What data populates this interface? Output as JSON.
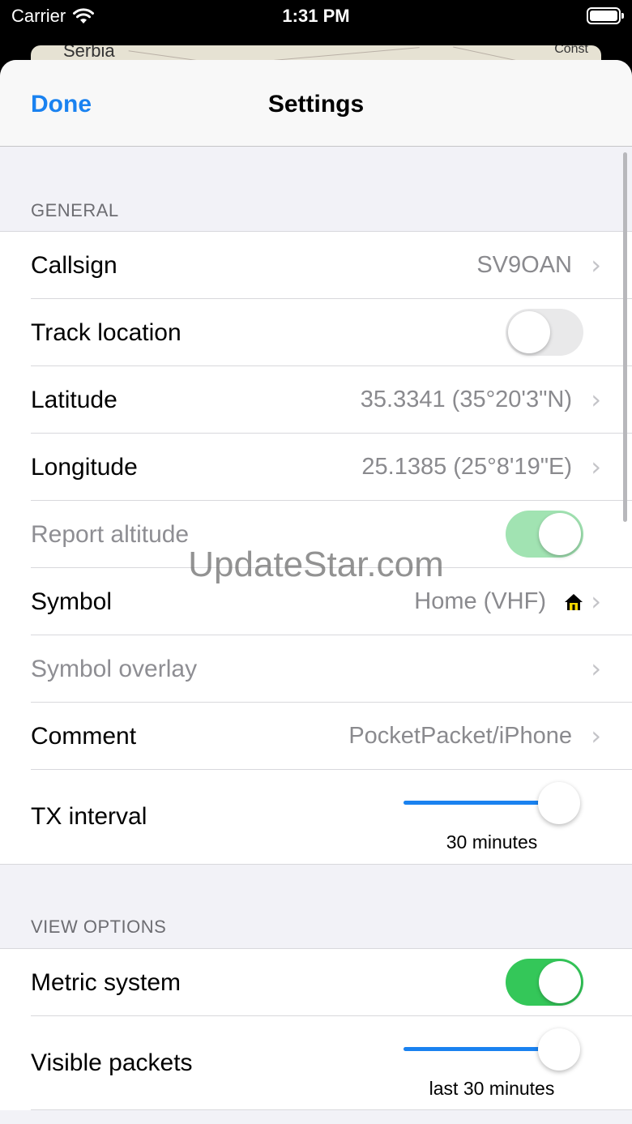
{
  "status_bar": {
    "carrier": "Carrier",
    "time": "1:31 PM"
  },
  "map": {
    "label_left": "Serbia",
    "label_right": "Const"
  },
  "nav": {
    "done_label": "Done",
    "title": "Settings"
  },
  "general": {
    "header": "GENERAL",
    "callsign": {
      "label": "Callsign",
      "value": "SV9OAN"
    },
    "track_location": {
      "label": "Track location",
      "on": false
    },
    "latitude": {
      "label": "Latitude",
      "value": "35.3341 (35°20'3\"N)"
    },
    "longitude": {
      "label": "Longitude",
      "value": "25.1385 (25°8'19\"E)"
    },
    "report_altitude": {
      "label": "Report altitude",
      "on": true,
      "enabled": false
    },
    "symbol": {
      "label": "Symbol",
      "value": "Home (VHF)",
      "icon": "house-icon"
    },
    "symbol_overlay": {
      "label": "Symbol overlay",
      "enabled": false
    },
    "comment": {
      "label": "Comment",
      "value": "PocketPacket/iPhone"
    },
    "tx_interval": {
      "label": "TX interval",
      "caption": "30 minutes",
      "slider_fraction": 1.0
    }
  },
  "view_options": {
    "header": "VIEW OPTIONS",
    "metric_system": {
      "label": "Metric system",
      "on": true
    },
    "visible_packets": {
      "label": "Visible packets",
      "caption": "last 30 minutes",
      "slider_fraction": 1.0
    }
  },
  "watermark": "UpdateStar.com",
  "colors": {
    "accent": "#1a82f0",
    "toggle_on": "#34c759"
  }
}
